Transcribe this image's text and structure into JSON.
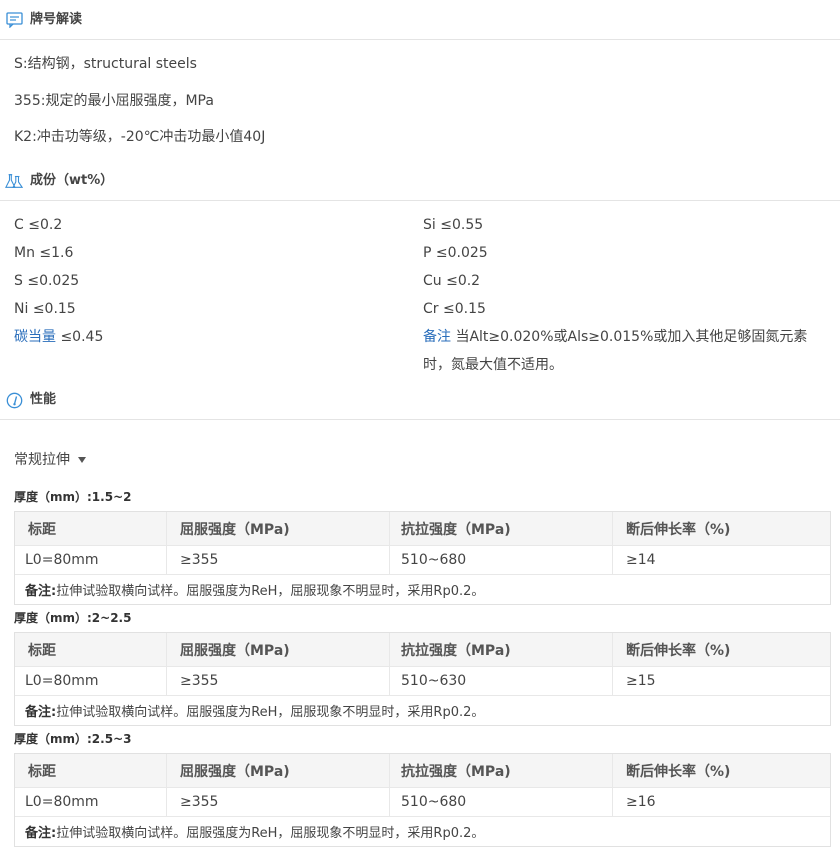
{
  "sections": {
    "grade": {
      "title": "牌号解读"
    },
    "composition": {
      "title": "成份（wt%）"
    },
    "properties": {
      "title": "性能"
    }
  },
  "grade_lines": [
    "S:结构钢，structural steels",
    "355:规定的最小屈服强度，MPa",
    "K2:冲击功等级，-20℃冲击功最小值40J"
  ],
  "composition": {
    "left": [
      "C ≤0.2",
      "Mn ≤1.6",
      "S ≤0.025",
      "Ni ≤0.15"
    ],
    "right": [
      "Si ≤0.55",
      "P ≤0.025",
      "Cu ≤0.2",
      "Cr ≤0.15"
    ],
    "ceq_label": "碳当量",
    "ceq_value": "≤0.45",
    "note_label": "备注",
    "note_text": "当Alt≥0.020%或Als≥0.015%或加入其他足够固氮元素时，氮最大值不适用。"
  },
  "properties": {
    "dropdown_label": "常规拉伸",
    "columns": [
      "标距",
      "屈服强度（MPa)",
      "抗拉强度（MPa)",
      "断后伸长率（%)"
    ],
    "note_label": "备注:",
    "note_text": "拉伸试验取横向试样。屈服强度为ReH，屈服现象不明显时，采用Rp0.2。",
    "tables": [
      {
        "thickness": "厚度（mm）:1.5~2",
        "row": [
          "L0=80mm",
          "≥355",
          "510~680",
          "≥14"
        ]
      },
      {
        "thickness": "厚度（mm）:2~2.5",
        "row": [
          "L0=80mm",
          "≥355",
          "510~630",
          "≥15"
        ]
      },
      {
        "thickness": "厚度（mm）:2.5~3",
        "row": [
          "L0=80mm",
          "≥355",
          "510~680",
          "≥16"
        ]
      }
    ]
  },
  "icons": {
    "grade": "comment-icon",
    "composition": "flask-icon",
    "properties": "gauge-icon",
    "accent": "#3a8fd6"
  }
}
